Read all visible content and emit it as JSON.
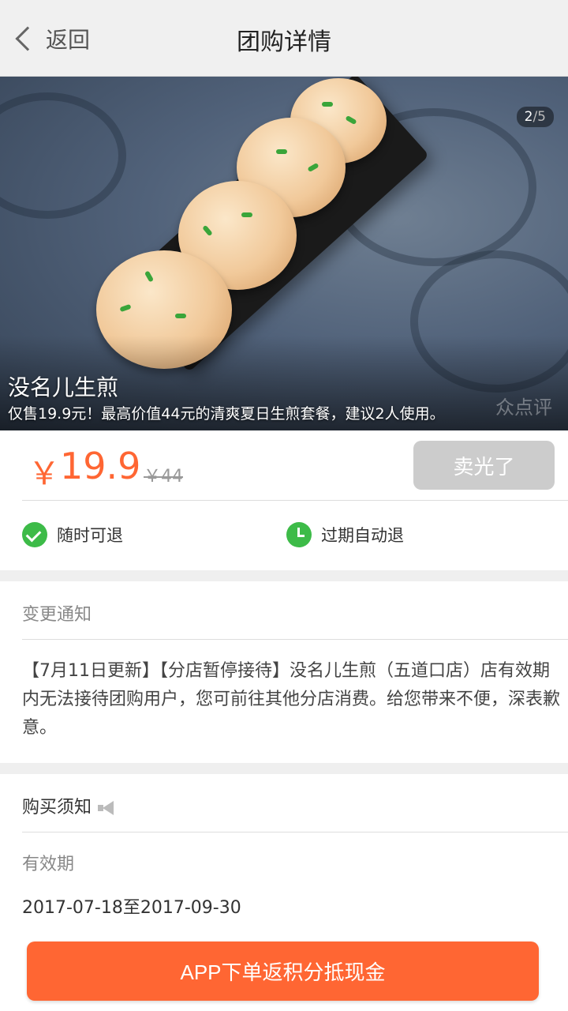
{
  "nav": {
    "back_label": "返回",
    "title": "团购详情"
  },
  "hero": {
    "image_counter_current": "2",
    "image_counter_total": "/5",
    "shop_name": "没名儿生煎",
    "deal_desc": "仅售19.9元！最高价值44元的清爽夏日生煎套餐，建议2人使用。",
    "watermark": "众点评"
  },
  "price": {
    "currency": "￥",
    "current": "19.9",
    "original": "￥44",
    "soldout_label": "卖光了"
  },
  "guarantees": [
    {
      "label": "随时可退",
      "icon": "check-circle-icon"
    },
    {
      "label": "过期自动退",
      "icon": "clock-icon"
    }
  ],
  "notice": {
    "title": "变更通知",
    "body": "【7月11日更新】【分店暂停接待】没名儿生煎（五道口店）店有效期内无法接待团购用户，您可前往其他分店消费。给您带来不便，深表歉意。"
  },
  "purchase": {
    "title": "购买须知",
    "validity_label": "有效期",
    "validity_value": "2017-07-18至2017-09-30"
  },
  "cta": {
    "label": "APP下单返积分抵现金"
  },
  "colors": {
    "accent": "#ff6633",
    "green": "#3dbb48",
    "disabled": "#cccccc"
  }
}
